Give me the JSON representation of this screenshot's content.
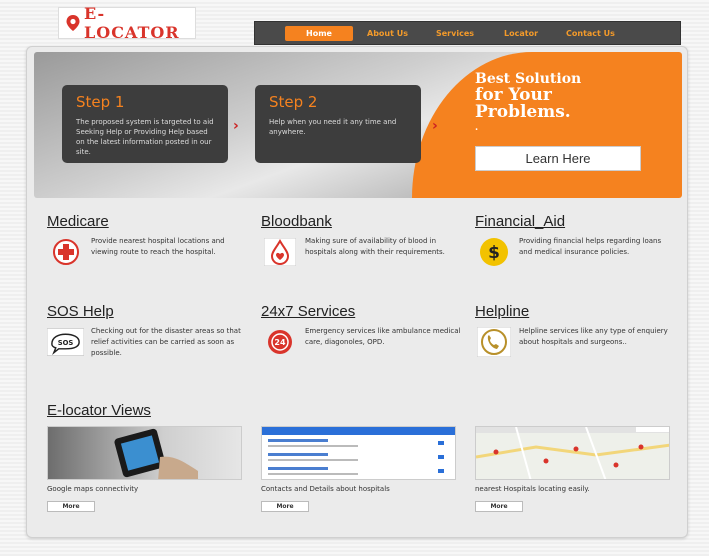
{
  "brand": {
    "logo_text": "E-LOCATOR"
  },
  "nav": {
    "items": [
      {
        "label": "Home",
        "active": true
      },
      {
        "label": "About Us"
      },
      {
        "label": "Services"
      },
      {
        "label": "Locator"
      },
      {
        "label": "Contact Us"
      }
    ]
  },
  "banner": {
    "step1": {
      "title": "Step 1",
      "text": "The proposed system is targeted to aid Seeking Help or Providing Help based on the latest information posted in our site."
    },
    "step2": {
      "title": "Step 2",
      "text": "Help when you need it any time and anywhere."
    },
    "tagline_line1": "Best Solution",
    "tagline_line2": "for Your",
    "tagline_line3": "Problems.",
    "tagline_dot": ".",
    "learn_label": "Learn Here"
  },
  "services": [
    {
      "title": "Medicare",
      "text": "Provide nearest hospital locations and viewing route to reach the hospital.",
      "icon": "red-cross-icon"
    },
    {
      "title": "Bloodbank",
      "text": "Making sure of availability of blood in hospitals along with their requirements.",
      "icon": "blood-drop-icon"
    },
    {
      "title": "Financial_Aid",
      "text": "Providing financial helps regarding loans and medical insurance policies.",
      "icon": "dollar-icon"
    },
    {
      "title": "SOS Help",
      "text": "Checking out for the disaster areas so that relief activities can be carried as soon as possible.",
      "icon": "sos-icon"
    },
    {
      "title": "24x7 Services",
      "text": "Emergency services like ambulance medical care, diagonoles, OPD.",
      "icon": "24x7-icon"
    },
    {
      "title": "Helpline",
      "text": "Helpline services like any type of enquiery about hospitals and surgeons..",
      "icon": "phone-icon"
    }
  ],
  "views": {
    "title": "E-locator Views",
    "items": [
      {
        "caption": "Google maps connectivity",
        "more": "More"
      },
      {
        "caption": "Contacts and Details about hospitals",
        "more": "More"
      },
      {
        "caption": "nearest Hospitals locating easily.",
        "more": "More"
      }
    ]
  },
  "colors": {
    "accent": "#f5821f",
    "dark": "#3d3d3d",
    "red": "#cc2222"
  }
}
